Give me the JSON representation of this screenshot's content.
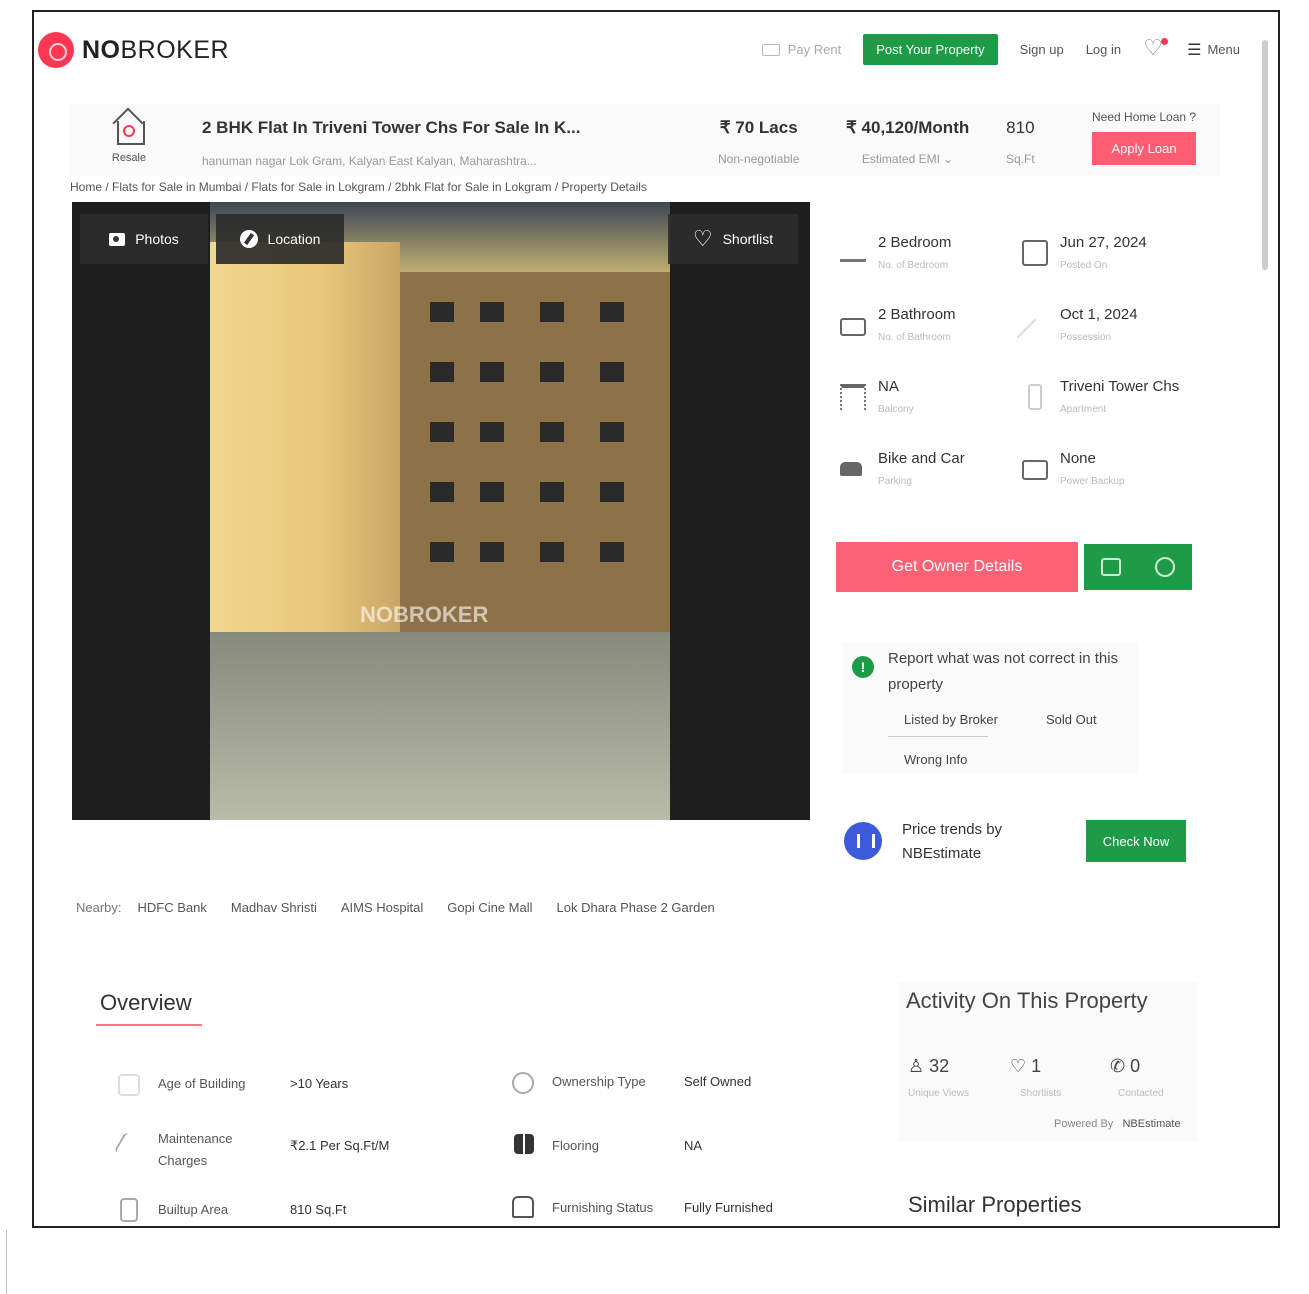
{
  "header": {
    "logo": {
      "no": "NO",
      "broker": "BROKER"
    },
    "nav": {
      "pay_rent": "Pay Rent",
      "post_property": "Post Your Property",
      "sign_up": "Sign up",
      "log_in": "Log in",
      "menu": "Menu"
    }
  },
  "listing": {
    "badge": "Resale",
    "title": "2 BHK Flat In Triveni Tower Chs For Sale In K...",
    "address": "hanuman nagar Lok Gram, Kalyan East Kalyan, Maharashtra...",
    "price": "₹ 70 Lacs",
    "price_note": "Non-negotiable",
    "emi": "₹ 40,120/Month",
    "emi_note": "Estimated EMI",
    "area": "810",
    "area_unit": "Sq.Ft",
    "loan_question": "Need Home Loan ?",
    "loan_button": "Apply Loan"
  },
  "breadcrumb": "Home / Flats for Sale in Mumbai / Flats for Sale in Lokgram / 2bhk Flat for Sale in Lokgram / Property Details",
  "gallery": {
    "photos": "Photos",
    "location": "Location",
    "shortlist": "Shortlist",
    "watermark": "NOBROKER"
  },
  "specs": [
    {
      "value": "2 Bedroom",
      "label": "No. of Bedroom",
      "icon": "bed-icon"
    },
    {
      "value": "Jun 27, 2024",
      "label": "Posted On",
      "icon": "calendar-icon"
    },
    {
      "value": "2 Bathroom",
      "label": "No. of Bathroom",
      "icon": "shower-icon"
    },
    {
      "value": "Oct 1, 2024",
      "label": "Possession",
      "icon": "key-icon"
    },
    {
      "value": "NA",
      "label": "Balcony",
      "icon": "balcony-icon"
    },
    {
      "value": "Triveni Tower Chs",
      "label": "Apartment",
      "icon": "building-icon"
    },
    {
      "value": "Bike and Car",
      "label": "Parking",
      "icon": "car-icon"
    },
    {
      "value": "None",
      "label": "Power Backup",
      "icon": "battery-icon"
    }
  ],
  "actions": {
    "owner_details": "Get Owner Details"
  },
  "report": {
    "text": "Report what was not correct in this property",
    "options": [
      "Listed by Broker",
      "Sold Out",
      "Wrong Info"
    ]
  },
  "trends": {
    "text_line1": "Price trends by",
    "text_line2": "NBEstimate",
    "button": "Check Now"
  },
  "nearby": {
    "label": "Nearby:",
    "places": [
      "HDFC Bank",
      "Madhav Shristi",
      "AIMS Hospital",
      "Gopi Cine Mall",
      "Lok Dhara Phase 2 Garden"
    ]
  },
  "overview": {
    "title": "Overview",
    "rows": [
      {
        "label": "Age of Building",
        "value": ">10 Years",
        "label2": "Ownership Type",
        "value2": "Self Owned"
      },
      {
        "label": "Maintenance Charges",
        "value": "₹2.1 Per Sq.Ft/M",
        "label2": "Flooring",
        "value2": "NA"
      },
      {
        "label": "Builtup Area",
        "value": "810 Sq.Ft",
        "label2": "Furnishing Status",
        "value2": "Fully Furnished"
      }
    ]
  },
  "activity": {
    "title": "Activity On This Property",
    "views": "32",
    "views_label": "Unique Views",
    "shortlists": "1",
    "shortlists_label": "Shortlists",
    "contacted": "0",
    "contacted_label": "Contacted",
    "powered": "Powered By",
    "powered_brand": "NBEstimate"
  },
  "similar": "Similar Properties",
  "colors": {
    "brand": "#fd3752",
    "green": "#1e9b47"
  }
}
